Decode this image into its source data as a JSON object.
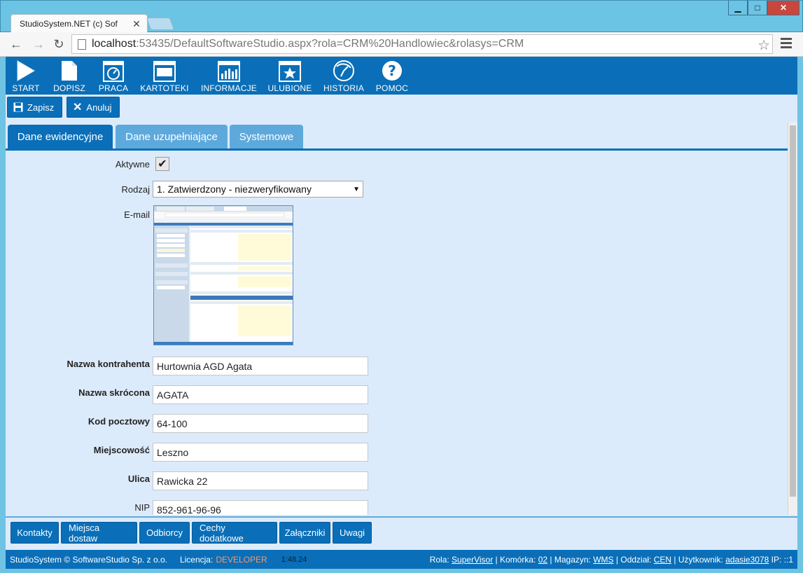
{
  "browser": {
    "tab_title": "StudioSystem.NET (c) Sof",
    "url_host": "localhost",
    "url_rest": ":53435/DefaultSoftwareStudio.aspx?rola=CRM%20Handlowiec&rolasys=CRM"
  },
  "toolbar": {
    "items": [
      {
        "label": "START",
        "icon": "play-icon"
      },
      {
        "label": "DOPISZ",
        "icon": "new-document-icon"
      },
      {
        "label": "PRACA",
        "icon": "dashboard-icon"
      },
      {
        "label": "KARTOTEKI",
        "icon": "monitor-icon"
      },
      {
        "label": "INFORMACJE",
        "icon": "bar-chart-icon"
      },
      {
        "label": "ULUBIONE",
        "icon": "star-window-icon"
      },
      {
        "label": "HISTORIA",
        "icon": "history-icon"
      },
      {
        "label": "POMOC",
        "icon": "help-icon"
      }
    ]
  },
  "actions": {
    "save_label": "Zapisz",
    "cancel_label": "Anuluj"
  },
  "tabs": [
    {
      "label": "Dane ewidencyjne",
      "active": true
    },
    {
      "label": "Dane uzupełniające",
      "active": false
    },
    {
      "label": "Systemowe",
      "active": false
    }
  ],
  "form": {
    "aktywne_label": "Aktywne",
    "aktywne_checked": true,
    "rodzaj_label": "Rodzaj",
    "rodzaj_value": "1. Zatwierdzony - niezweryfikowany",
    "email_label": "E-mail",
    "nazwa_label": "Nazwa kontrahenta",
    "nazwa_value": "Hurtownia AGD Agata",
    "skrocona_label": "Nazwa skrócona",
    "skrocona_value": "AGATA",
    "kod_label": "Kod pocztowy",
    "kod_value": "64-100",
    "miejscowosc_label": "Miejscowość",
    "miejscowosc_value": "Leszno",
    "ulica_label": "Ulica",
    "ulica_value": "Rawicka 22",
    "nip_label": "NIP",
    "nip_value": "852-961-96-96"
  },
  "bottom_tabs": [
    "Kontakty",
    "Miejsca dostaw",
    "Odbiorcy",
    "Cechy dodatkowe",
    "Załączniki",
    "Uwagi"
  ],
  "status": {
    "copyright": "StudioSystem © SoftwareStudio Sp. z o.o.",
    "license_label": "Licencja:",
    "license_value": "DEVELOPER",
    "timer": "1:48.24",
    "rola_label": "Rola:",
    "rola_value": "SuperVisor",
    "komorka_label": "Komórka:",
    "komorka_value": "02",
    "magazyn_label": "Magazyn:",
    "magazyn_value": "WMS",
    "oddzial_label": "Oddział:",
    "oddzial_value": "CEN",
    "uzytkownik_label": "Użytkownik:",
    "uzytkownik_value": "adasie3078",
    "ip_label": "IP:",
    "ip_value": "::1"
  },
  "colors": {
    "primary": "#0a6fb8",
    "tab_inactive": "#5ea9dc",
    "content_bg": "#dcebfb",
    "license_accent": "#f39a6a"
  }
}
